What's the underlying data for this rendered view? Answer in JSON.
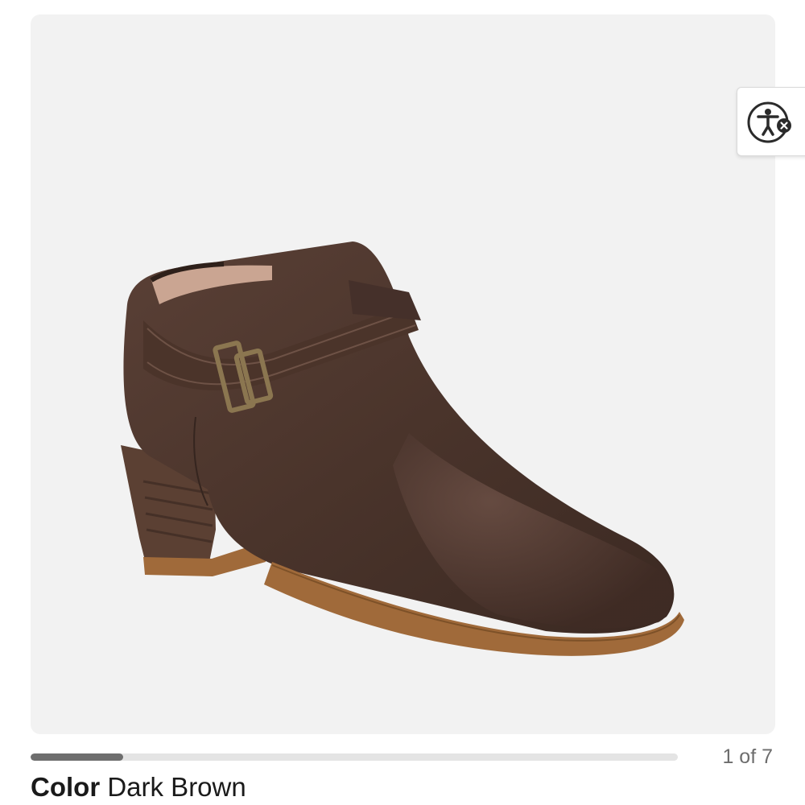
{
  "gallery": {
    "image_alt": "Dark brown ankle bootie with buckle strap",
    "current_index": 1,
    "total": 7,
    "counter_text": "1 of 7",
    "progress_fraction": 0.143
  },
  "product": {
    "color_label": "Color",
    "color_value": "Dark Brown"
  },
  "accessibility": {
    "icon": "accessibility-icon"
  },
  "colors": {
    "gallery_bg": "#f2f2f2",
    "boot_leather": "#4a342b",
    "sole": "#a06a3a",
    "progress_fill": "#6e6e6e",
    "progress_track": "#e4e4e4",
    "accent": "#2b2b2b"
  }
}
